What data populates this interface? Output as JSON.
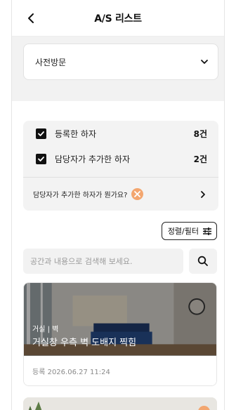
{
  "header": {
    "title": "A/S 리스트"
  },
  "filter": {
    "selected": "사전방문"
  },
  "checks": [
    {
      "label": "등록한 하자",
      "count": "8건"
    },
    {
      "label": "담당자가 추가한 하자",
      "count": "2건"
    }
  ],
  "help": {
    "label": "담당자가 추가한 하자가 뭔가요?"
  },
  "sort": {
    "label": "정렬/필터"
  },
  "search": {
    "placeholder": "공간과 내용으로 검색해 보세요."
  },
  "items": [
    {
      "category": "거실 | 벽",
      "title": "거실창 우측 벽 도배지 찍힘",
      "registered": "등록  2026.06.27 11:24"
    }
  ],
  "colors": {
    "accent": "#f3a66f",
    "panel": "#f2f2f2"
  }
}
